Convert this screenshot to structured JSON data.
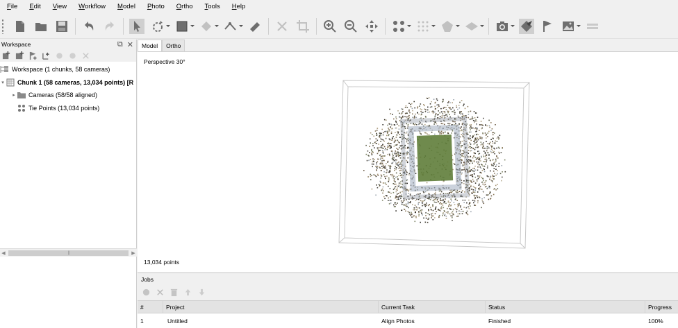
{
  "menu": [
    {
      "u": "F",
      "rest": "ile"
    },
    {
      "u": "E",
      "rest": "dit"
    },
    {
      "u": "V",
      "rest": "iew"
    },
    {
      "u": "W",
      "rest": "orkflow"
    },
    {
      "u": "M",
      "rest": "odel"
    },
    {
      "u": "P",
      "rest": "hoto"
    },
    {
      "u": "O",
      "rest": "rtho"
    },
    {
      "u": "T",
      "rest": "ools"
    },
    {
      "u": "H",
      "rest": "elp"
    }
  ],
  "workspace_panel": {
    "title": "Workspace",
    "tree": {
      "workspace": "Workspace (1 chunks, 58 cameras)",
      "chunk": "Chunk 1 (58 cameras, 13,034 points) [R",
      "cameras": "Cameras (58/58 aligned)",
      "tie_points": "Tie Points (13,034 points)"
    }
  },
  "viewport": {
    "tabs": [
      "Model",
      "Ortho"
    ],
    "active_tab": "Model",
    "projection_label": "Perspective 30°",
    "points_label": "13,034 points"
  },
  "jobs": {
    "title": "Jobs",
    "columns": [
      "#",
      "Project",
      "Current Task",
      "Status",
      "Progress"
    ],
    "rows": [
      {
        "num": "1",
        "project": "Untitled",
        "task": "Align Photos",
        "status": "Finished",
        "progress": "100%"
      }
    ]
  },
  "colors": {
    "window_bg": "#f0f0f0",
    "viewport_bg": "#ffffff",
    "icon_gray": "#6e6e6e",
    "field_green": "#5f7d3a"
  },
  "icons": {
    "toolbar": [
      "new-document-icon",
      "open-folder-icon",
      "save-icon",
      "undo-icon",
      "redo-icon",
      "pointer-icon",
      "rotate-select-icon",
      "rectangle-select-icon",
      "shape-icon",
      "polyline-icon",
      "ruler-icon",
      "delete-icon",
      "crop-icon",
      "zoom-in-icon",
      "zoom-out-icon",
      "move-icon",
      "points-icon",
      "dense-points-icon",
      "mesh-icon",
      "textured-mesh-icon",
      "camera-icon",
      "show-cameras-icon",
      "flag-icon",
      "image-icon",
      "layers-icon"
    ]
  }
}
